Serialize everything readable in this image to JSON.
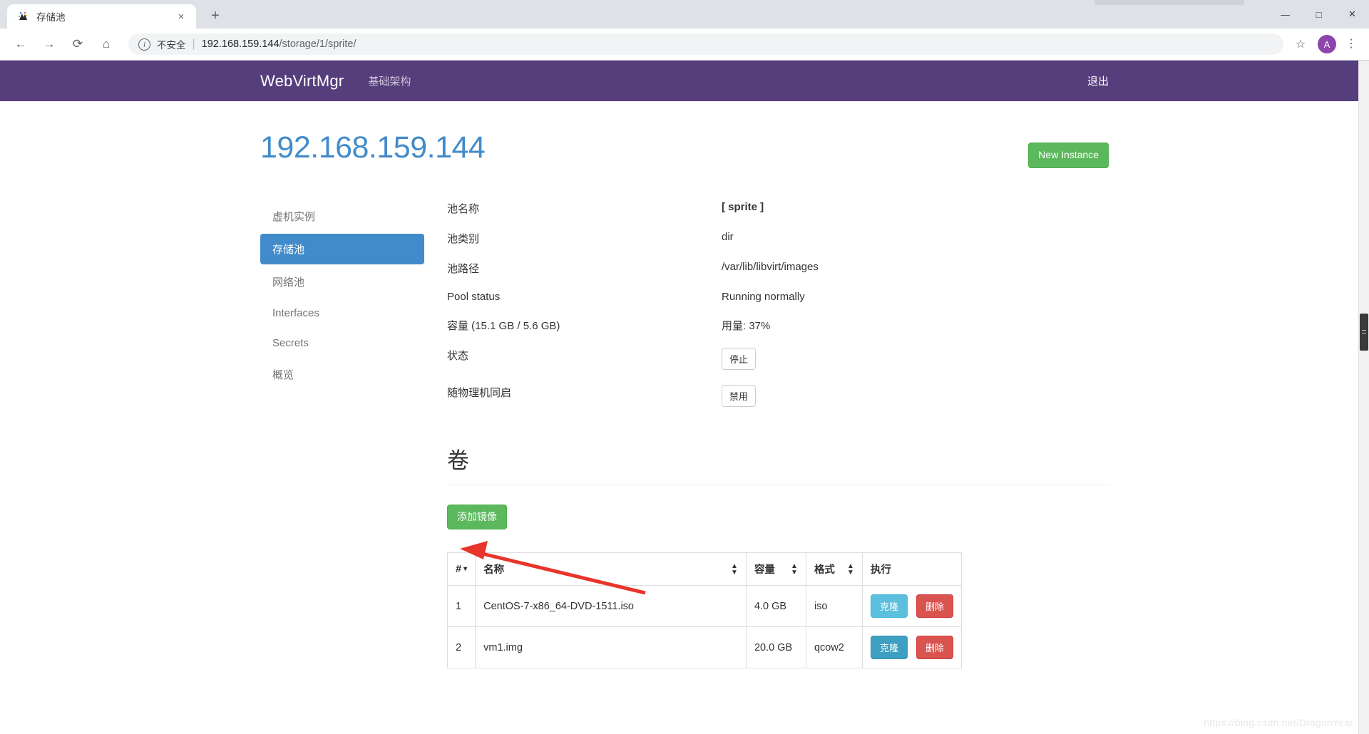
{
  "browser": {
    "tab": {
      "title": "存储池",
      "favicon_icon": "webvirtmgr-favicon",
      "close_icon": "×"
    },
    "newtab_icon": "+",
    "window": {
      "minimize": "—",
      "maximize": "□",
      "close": "✕"
    },
    "toolbar": {
      "back_icon": "←",
      "forward_icon": "→",
      "reload_icon": "⟳",
      "home_icon": "⌂",
      "info_icon": "ⓘ",
      "security_label": "不安全",
      "separator": "|",
      "url_host": "192.168.159.144",
      "url_path": "/storage/1/sprite/",
      "star_icon": "☆",
      "avatar_initial": "A",
      "menu_icon": "⋮"
    }
  },
  "navbar": {
    "brand": "WebVirtMgr",
    "links": [
      "基础架构"
    ],
    "logout": "退出",
    "bg_color": "#563d7c"
  },
  "page": {
    "title": "192.168.159.144",
    "title_color": "#428bca",
    "new_instance_button": "New Instance"
  },
  "sidebar": {
    "items": [
      {
        "label": "虚机实例",
        "active": false
      },
      {
        "label": "存储池",
        "active": true
      },
      {
        "label": "网络池",
        "active": false
      },
      {
        "label": "Interfaces",
        "active": false
      },
      {
        "label": "Secrets",
        "active": false
      },
      {
        "label": "概览",
        "active": false
      }
    ],
    "active_color": "#428bca"
  },
  "details": [
    {
      "term": "池名称",
      "value": "[ sprite ]",
      "bold": true,
      "type": "text"
    },
    {
      "term": "池类别",
      "value": "dir",
      "type": "text"
    },
    {
      "term": "池路径",
      "value": "/var/lib/libvirt/images",
      "type": "text"
    },
    {
      "term": "Pool status",
      "value": "Running normally",
      "type": "text"
    },
    {
      "term": "容量 (15.1 GB / 5.6 GB)",
      "value": "用量: 37%",
      "type": "text"
    },
    {
      "term": "状态",
      "value": "停止",
      "type": "button"
    },
    {
      "term": "随物理机同启",
      "value": "禁用",
      "type": "button"
    }
  ],
  "volumes": {
    "heading": "卷",
    "add_button": "添加镜像",
    "columns": [
      "#",
      "名称",
      "容量",
      "格式",
      "执行"
    ],
    "sort_caret_icon": "▾",
    "sort_icon": "⇅",
    "rows": [
      {
        "index": "1",
        "name": "CentOS-7-x86_64-DVD-1511.iso",
        "capacity": "4.0 GB",
        "format": "iso",
        "clone_label": "克隆",
        "delete_label": "删除"
      },
      {
        "index": "2",
        "name": "vm1.img",
        "capacity": "20.0 GB",
        "format": "qcow2",
        "clone_label": "克隆",
        "delete_label": "删除"
      }
    ]
  },
  "annotation": {
    "arrow_color": "#e8342a"
  },
  "watermark": "https://blog.csdn.net/DragonYear"
}
